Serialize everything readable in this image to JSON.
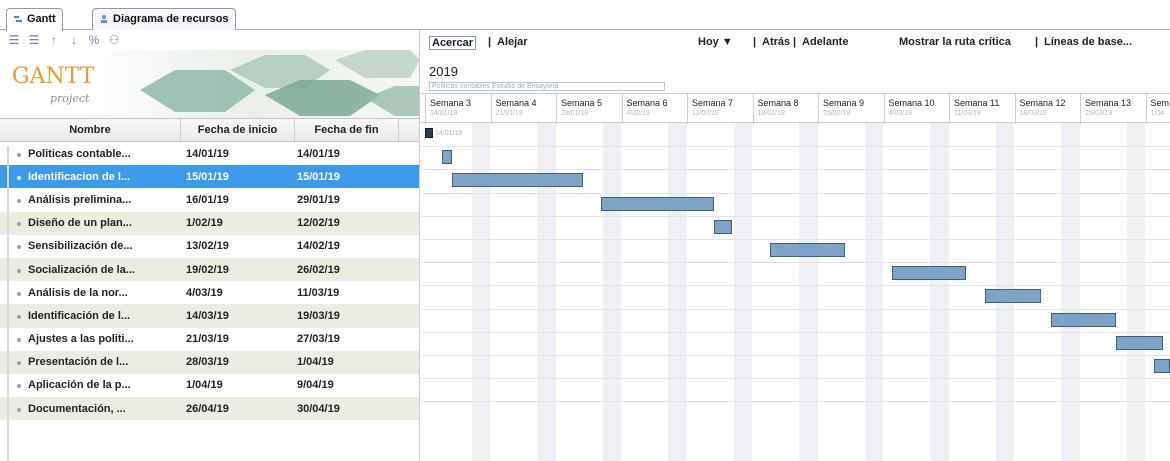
{
  "tabs": [
    {
      "label": "Gantt",
      "icon": "gantt-icon",
      "active": true
    },
    {
      "label": "Diagrama de recursos",
      "icon": "resources-icon",
      "active": false
    }
  ],
  "toolbar": {
    "icons": [
      "indent-icon",
      "outdent-icon",
      "move-up-icon",
      "move-down-icon",
      "link-icon",
      "unlink-icon"
    ]
  },
  "logo": {
    "text": "GANTT",
    "sub": "project"
  },
  "grid": {
    "headers": {
      "name": "Nombre",
      "start": "Fecha de inicio",
      "end": "Fecha de fin"
    },
    "rows": [
      {
        "name": "Politicas contable...",
        "start": "14/01/19",
        "end": "14/01/19"
      },
      {
        "name": "Identificacion de l...",
        "start": "15/01/19",
        "end": "15/01/19"
      },
      {
        "name": "Análisis prelimina...",
        "start": "16/01/19",
        "end": "29/01/19"
      },
      {
        "name": "Diseño de un plan...",
        "start": "1/02/19",
        "end": "12/02/19"
      },
      {
        "name": "Sensibilización de...",
        "start": "13/02/19",
        "end": "14/02/19"
      },
      {
        "name": "Socialización de la...",
        "start": "19/02/19",
        "end": "26/02/19"
      },
      {
        "name": "Análisis de la nor...",
        "start": "4/03/19",
        "end": "11/03/19"
      },
      {
        "name": "Identificación de l...",
        "start": "14/03/19",
        "end": "19/03/19"
      },
      {
        "name": "Ajustes a las politi...",
        "start": "21/03/19",
        "end": "27/03/19"
      },
      {
        "name": "Presentación de l...",
        "start": "28/03/19",
        "end": "1/04/19"
      },
      {
        "name": "Aplicación de la p...",
        "start": "1/04/19",
        "end": "9/04/19"
      },
      {
        "name": "Documentación, ...",
        "start": "26/04/19",
        "end": "30/04/19"
      }
    ]
  },
  "chart_toolbar": {
    "zoom_in": "Acercar",
    "sep1": "|",
    "zoom_out": "Alejar",
    "today": "Hoy ▼",
    "sep2": "|",
    "back": "Atrás",
    "sep3": "|",
    "forward": "Adelante",
    "critical_path": "Mostrar la ruta crítica",
    "sep4": "|",
    "baselines": "Líneas de base..."
  },
  "timeline": {
    "year": "2019",
    "year_strip": "Politicas contables Estudio de Ensayoría",
    "weeks": [
      {
        "label": "Semana 3",
        "date": "14/01/19"
      },
      {
        "label": "Semana 4",
        "date": "21/01/19"
      },
      {
        "label": "Semana 5",
        "date": "28/01/19"
      },
      {
        "label": "Semana 6",
        "date": "4/02/19"
      },
      {
        "label": "Semana 7",
        "date": "11/02/19"
      },
      {
        "label": "Semana 8",
        "date": "18/02/19"
      },
      {
        "label": "Semana 9",
        "date": "25/02/19"
      },
      {
        "label": "Semana 10",
        "date": "4/03/19"
      },
      {
        "label": "Semana 11",
        "date": "11/03/19"
      },
      {
        "label": "Semana 12",
        "date": "18/03/19"
      },
      {
        "label": "Semana 13",
        "date": "25/03/19"
      },
      {
        "label": "Sem",
        "date": "1/04"
      }
    ],
    "milestone_label": "14/01/19"
  },
  "selected_row": 1
}
